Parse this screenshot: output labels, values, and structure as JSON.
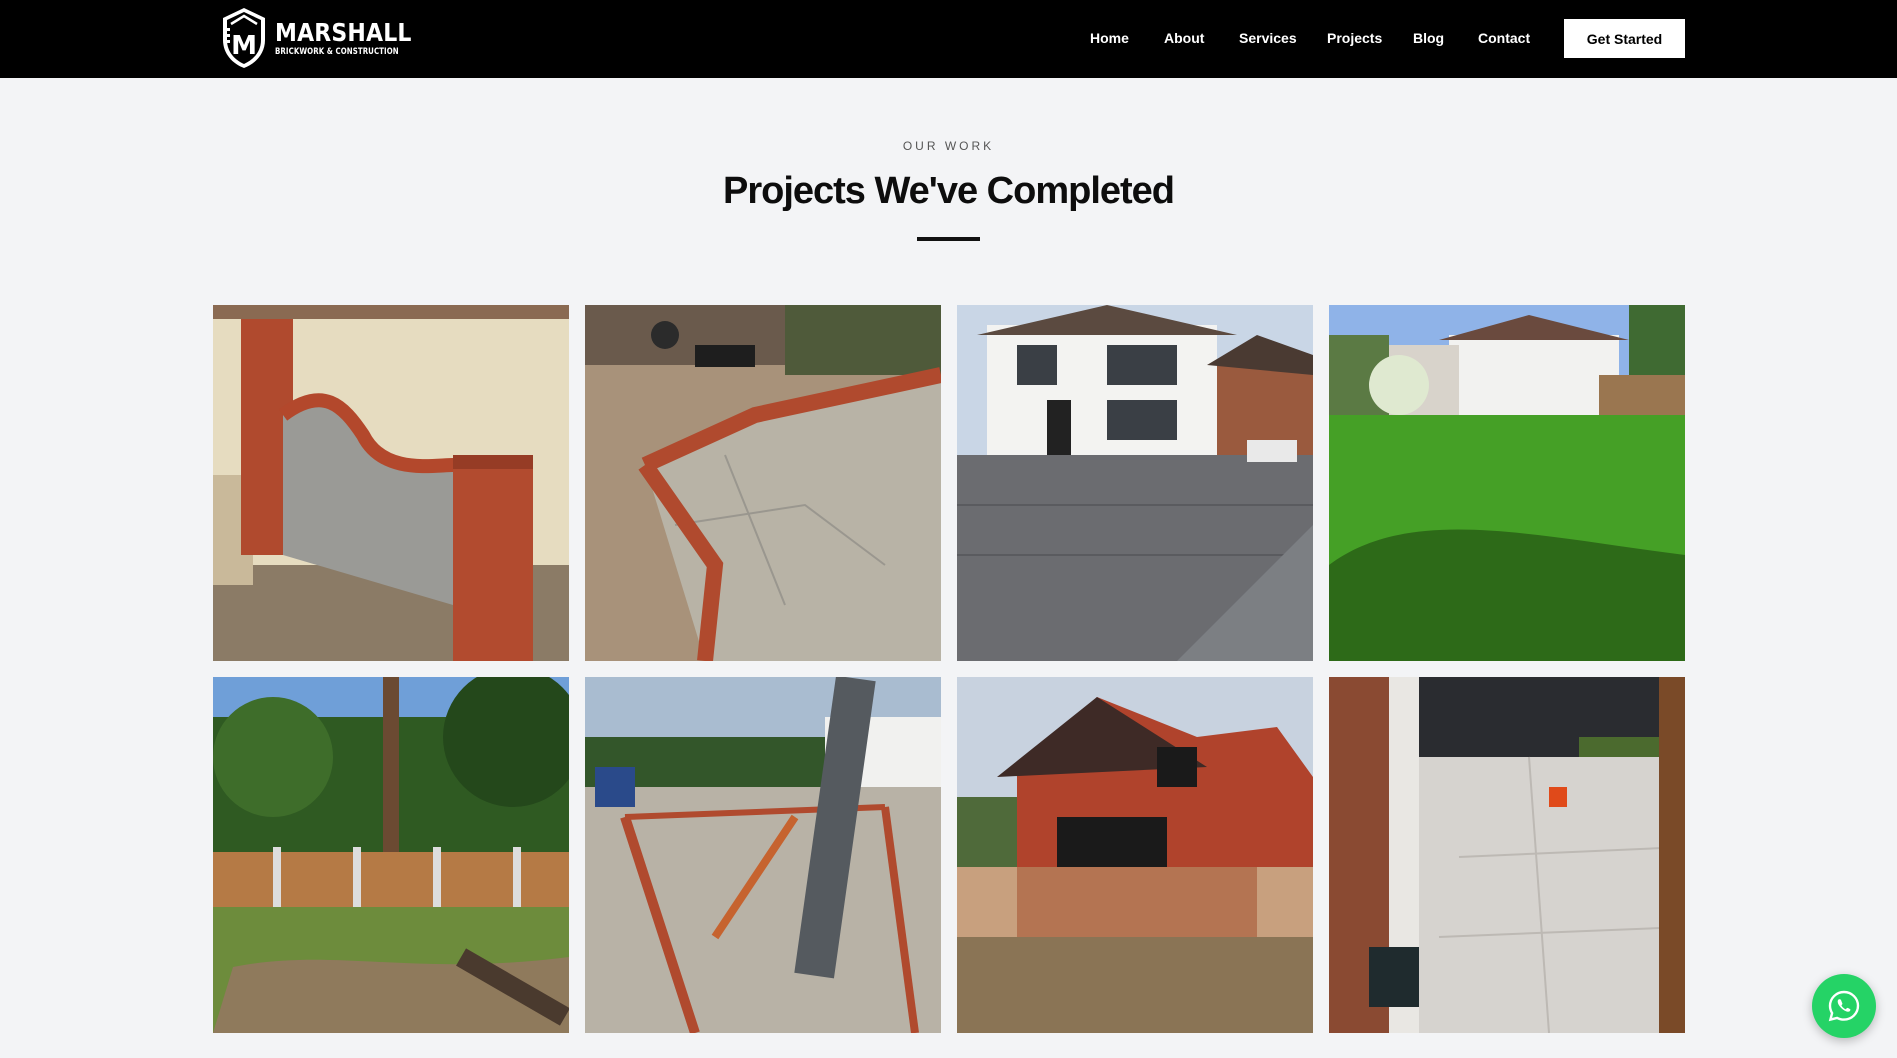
{
  "brand": {
    "name": "MARSHALL",
    "tagline": "BRICKWORK & CONSTRUCTION",
    "logo_letter": "M"
  },
  "nav": {
    "items": [
      "Home",
      "About",
      "Services",
      "Projects",
      "Blog",
      "Contact"
    ],
    "cta_label": "Get Started"
  },
  "section": {
    "eyebrow": "OUR WORK",
    "title": "Projects We've Completed"
  },
  "gallery": {
    "images": [
      {
        "subject": "curved brick wall with rendered face"
      },
      {
        "subject": "sandstone patio with brick edging"
      },
      {
        "subject": "house with block paved driveway"
      },
      {
        "subject": "artificial lawn in rear garden"
      },
      {
        "subject": "new wooden panel fence with trees"
      },
      {
        "subject": "building foundation and groundworks"
      },
      {
        "subject": "house extension with hanging tiles"
      },
      {
        "subject": "grey porcelain patio slabs"
      }
    ]
  },
  "floating": {
    "whatsapp_icon": "whatsapp-icon",
    "color": "#25d366"
  },
  "colors": {
    "header_bg": "#000000",
    "page_bg": "#f3f4f6",
    "accent": "#111111"
  }
}
